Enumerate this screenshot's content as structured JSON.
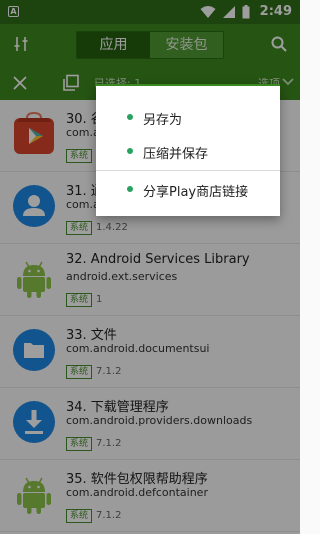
{
  "status_bar": {
    "app_icon_letter": "A",
    "time": "2:49"
  },
  "toolbar": {
    "tabs": [
      {
        "label": "应用",
        "active": true
      },
      {
        "label": "安装包",
        "active": false
      }
    ]
  },
  "action_bar": {
    "selected_text": "已选择: 1",
    "options_text": "选项"
  },
  "apps": [
    {
      "title": "30. 谷",
      "package": "com.a",
      "badge": "系统",
      "version": ""
    },
    {
      "title": "31. 通",
      "package": "com.a",
      "badge": "系统",
      "version": "1.4.22"
    },
    {
      "title": "32. Android Services Library",
      "package": "android.ext.services",
      "badge": "系统",
      "version": "1"
    },
    {
      "title": "33. 文件",
      "package": "com.android.documentsui",
      "badge": "系统",
      "version": "7.1.2"
    },
    {
      "title": "34. 下载管理程序",
      "package": "com.android.providers.downloads",
      "badge": "系统",
      "version": "7.1.2"
    },
    {
      "title": "35. 软件包权限帮助程序",
      "package": "com.android.defcontainer",
      "badge": "系统",
      "version": "7.1.2"
    }
  ],
  "popup_menu": {
    "items": [
      {
        "label": "另存为"
      },
      {
        "label": "压缩并保存"
      },
      {
        "label": "分享Play商店链接"
      }
    ]
  },
  "colors": {
    "primary": "#3c8820",
    "status": "#2f6e17",
    "accent_dot": "#27a35f"
  }
}
